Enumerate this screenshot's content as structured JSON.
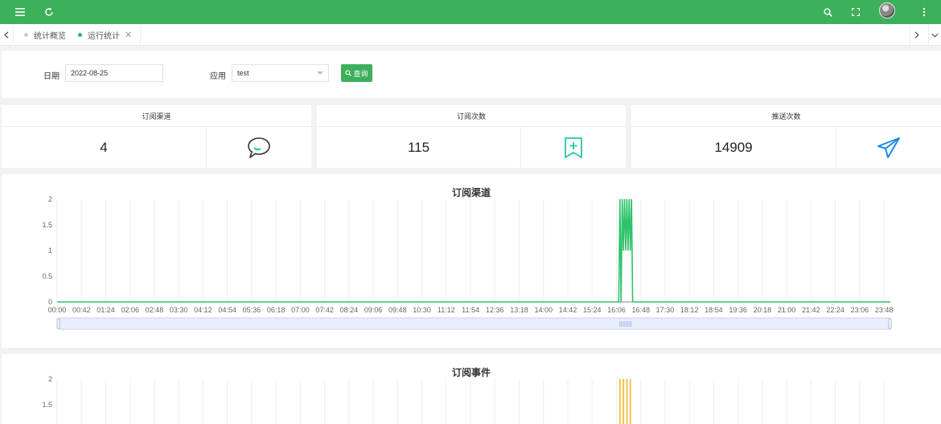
{
  "colors": {
    "primary": "#3cb05a",
    "series1": "#2ec26a",
    "series2": "#f5c04a",
    "accent_blue": "#1e88e5",
    "teal": "#26c6a2"
  },
  "topbar": {
    "left_icons": [
      "menu-icon",
      "refresh-icon"
    ],
    "right_icons": [
      "search-icon",
      "fullscreen-icon",
      "avatar",
      "more-vertical-icon"
    ]
  },
  "tabs": [
    {
      "label": "统计概览",
      "active": false
    },
    {
      "label": "运行统计",
      "active": true
    }
  ],
  "filter": {
    "date_label": "日期",
    "date_value": "2022-08-25",
    "app_label": "应用",
    "app_value": "test",
    "query_button": "查询"
  },
  "stats": [
    {
      "title": "订阅渠道",
      "value": "4",
      "icon": "chat-bubble-icon"
    },
    {
      "title": "订阅次数",
      "value": "115",
      "icon": "bookmark-add-icon"
    },
    {
      "title": "推送次数",
      "value": "14909",
      "icon": "paper-plane-icon"
    }
  ],
  "chart_data": [
    {
      "type": "line",
      "title": "订阅渠道",
      "ylim": [
        0,
        2
      ],
      "y_ticks": [
        "0",
        "0.5",
        "1",
        "1.5",
        "2"
      ],
      "x_ticks": [
        "00:00",
        "00:42",
        "01:24",
        "02:06",
        "02:48",
        "03:30",
        "04:12",
        "04:54",
        "05:36",
        "06:18",
        "07:00",
        "07:42",
        "08:24",
        "09:06",
        "09:48",
        "10:30",
        "11:12",
        "11:54",
        "12:36",
        "13:18",
        "14:00",
        "14:42",
        "15:24",
        "16:06",
        "16:48",
        "17:30",
        "18:12",
        "18:54",
        "19:36",
        "20:18",
        "21:00",
        "21:42",
        "22:24",
        "23:06",
        "23:48"
      ],
      "x_range": [
        "00:00",
        "23:59"
      ],
      "baseline": 0,
      "spikes": [
        {
          "x": "16:12",
          "y": 2
        },
        {
          "x": "16:14",
          "y": 0
        },
        {
          "x": "16:16",
          "y": 2
        },
        {
          "x": "16:18",
          "y": 1
        },
        {
          "x": "16:20",
          "y": 2
        },
        {
          "x": "16:22",
          "y": 1
        },
        {
          "x": "16:24",
          "y": 2
        },
        {
          "x": "16:26",
          "y": 1
        },
        {
          "x": "16:28",
          "y": 2
        },
        {
          "x": "16:30",
          "y": 1
        },
        {
          "x": "16:32",
          "y": 2
        }
      ],
      "spike_end": "16:34",
      "grid": true,
      "zoom_slider": true
    },
    {
      "type": "line",
      "title": "订阅事件",
      "ylim": [
        0,
        2
      ],
      "y_ticks": [
        "1.5",
        "2"
      ],
      "x_range": [
        "00:00",
        "23:59"
      ],
      "spikes": [
        {
          "x": "16:12",
          "y": 2
        },
        {
          "x": "16:18",
          "y": 2
        },
        {
          "x": "16:24",
          "y": 2
        },
        {
          "x": "16:30",
          "y": 2
        }
      ],
      "grid": true
    }
  ]
}
